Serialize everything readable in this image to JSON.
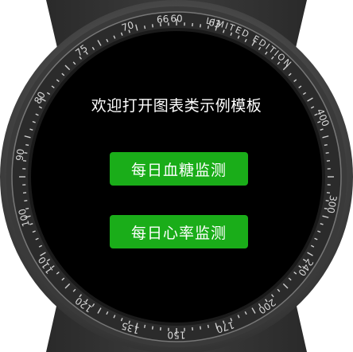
{
  "watch": {
    "bezel_label": "LIMITED EDITION",
    "bezel_numbers": [
      "60",
      "400",
      "300",
      "240",
      "200",
      "170",
      "150",
      "135",
      "120",
      "110",
      "100",
      "90",
      "80",
      "75",
      "70",
      "66",
      "63"
    ]
  },
  "screen": {
    "title": "欢迎打开图表类示例模板",
    "buttons": [
      {
        "label": "每日血糖监测"
      },
      {
        "label": "每日心率监测"
      }
    ]
  },
  "colors": {
    "button_green": "#1aad19",
    "screen_bg": "#000000",
    "bezel": "#2b2b2b"
  }
}
